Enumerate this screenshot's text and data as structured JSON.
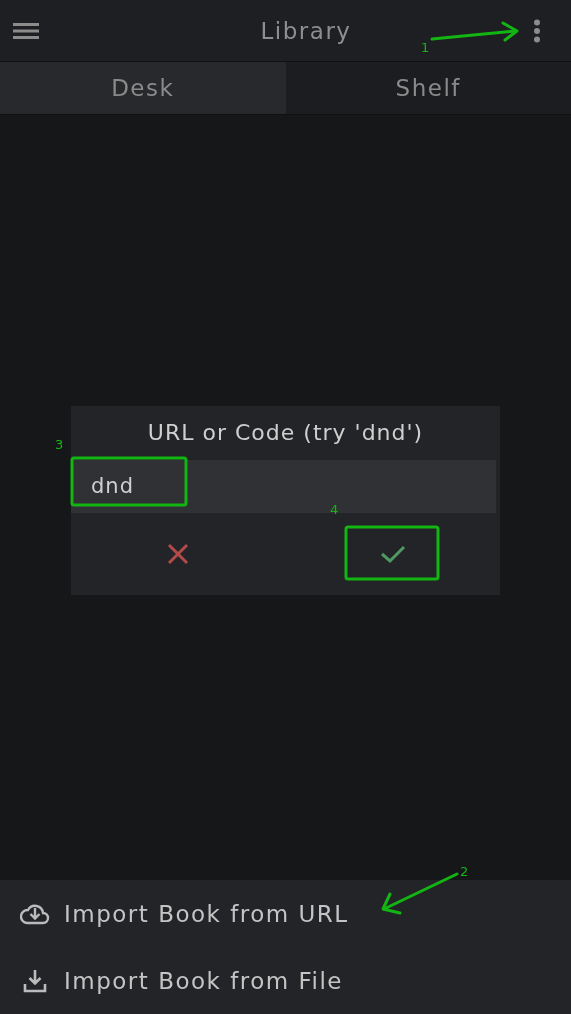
{
  "header": {
    "title": "Library"
  },
  "tabs": [
    {
      "label": "Desk",
      "selected": true
    },
    {
      "label": "Shelf",
      "selected": false
    }
  ],
  "dialog": {
    "title": "URL or Code (try 'dnd')",
    "value": "dnd"
  },
  "menu": [
    {
      "label": "Import Book from URL",
      "kind": "cloud"
    },
    {
      "label": "Import Book from File",
      "kind": "download"
    }
  ],
  "annotations": [
    {
      "label": "1",
      "kind": "arrow"
    },
    {
      "label": "2",
      "kind": "arrow"
    },
    {
      "label": "3",
      "kind": "box"
    },
    {
      "label": "4",
      "kind": "box"
    }
  ]
}
